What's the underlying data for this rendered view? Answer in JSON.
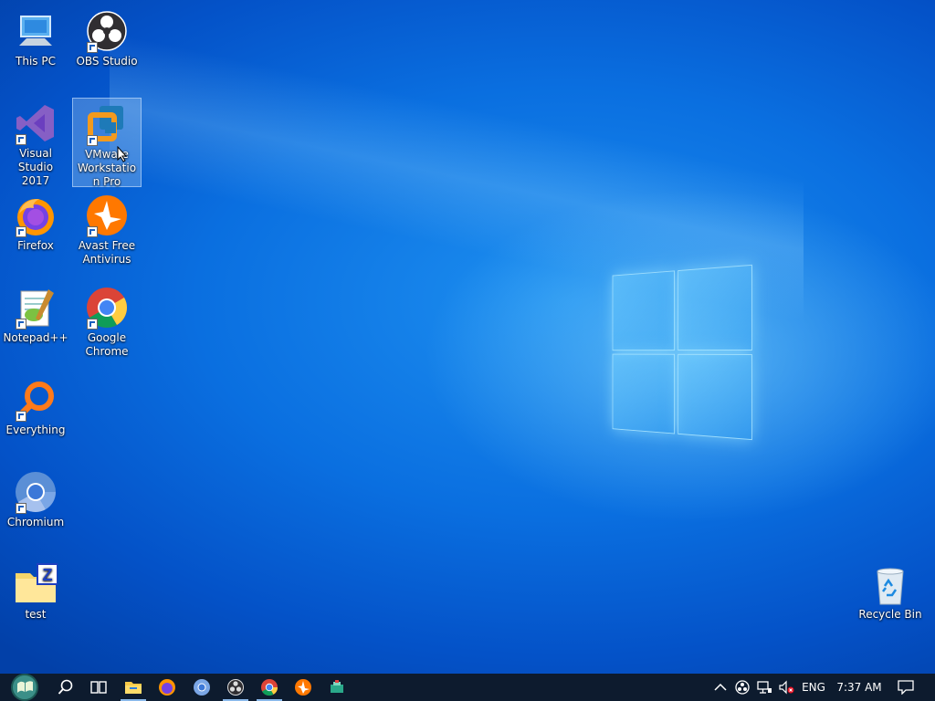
{
  "desktop": {
    "icons": [
      {
        "label": "This PC",
        "icon": "computer-icon"
      },
      {
        "label": "OBS Studio",
        "icon": "obs-icon"
      },
      {
        "label": "Visual Studio 2017",
        "icon": "visual-studio-icon"
      },
      {
        "label": "VMware Workstation Pro",
        "icon": "vmware-icon"
      },
      {
        "label": "Firefox",
        "icon": "firefox-icon"
      },
      {
        "label": "Avast Free Antivirus",
        "icon": "avast-icon"
      },
      {
        "label": "Notepad++",
        "icon": "notepadpp-icon"
      },
      {
        "label": "Google Chrome",
        "icon": "chrome-icon"
      },
      {
        "label": "Everything",
        "icon": "everything-icon"
      },
      {
        "label": "Chromium",
        "icon": "chromium-icon"
      },
      {
        "label": "test",
        "icon": "zip-folder-icon"
      },
      {
        "label": "Recycle Bin",
        "icon": "recycle-bin-icon"
      }
    ],
    "selected_icon": "VMware Workstation Pro"
  },
  "taskbar": {
    "buttons": [
      "start-icon",
      "search-icon",
      "task-view-icon",
      "file-explorer-icon",
      "firefox-icon",
      "chromium-icon",
      "obs-icon",
      "chrome-icon",
      "avast-icon",
      "app-icon"
    ],
    "tray": {
      "language": "ENG",
      "time": "7:37 AM"
    }
  },
  "colors": {
    "taskbar": "#0d1b2e",
    "desktop_accent": "#0a6fe0"
  }
}
